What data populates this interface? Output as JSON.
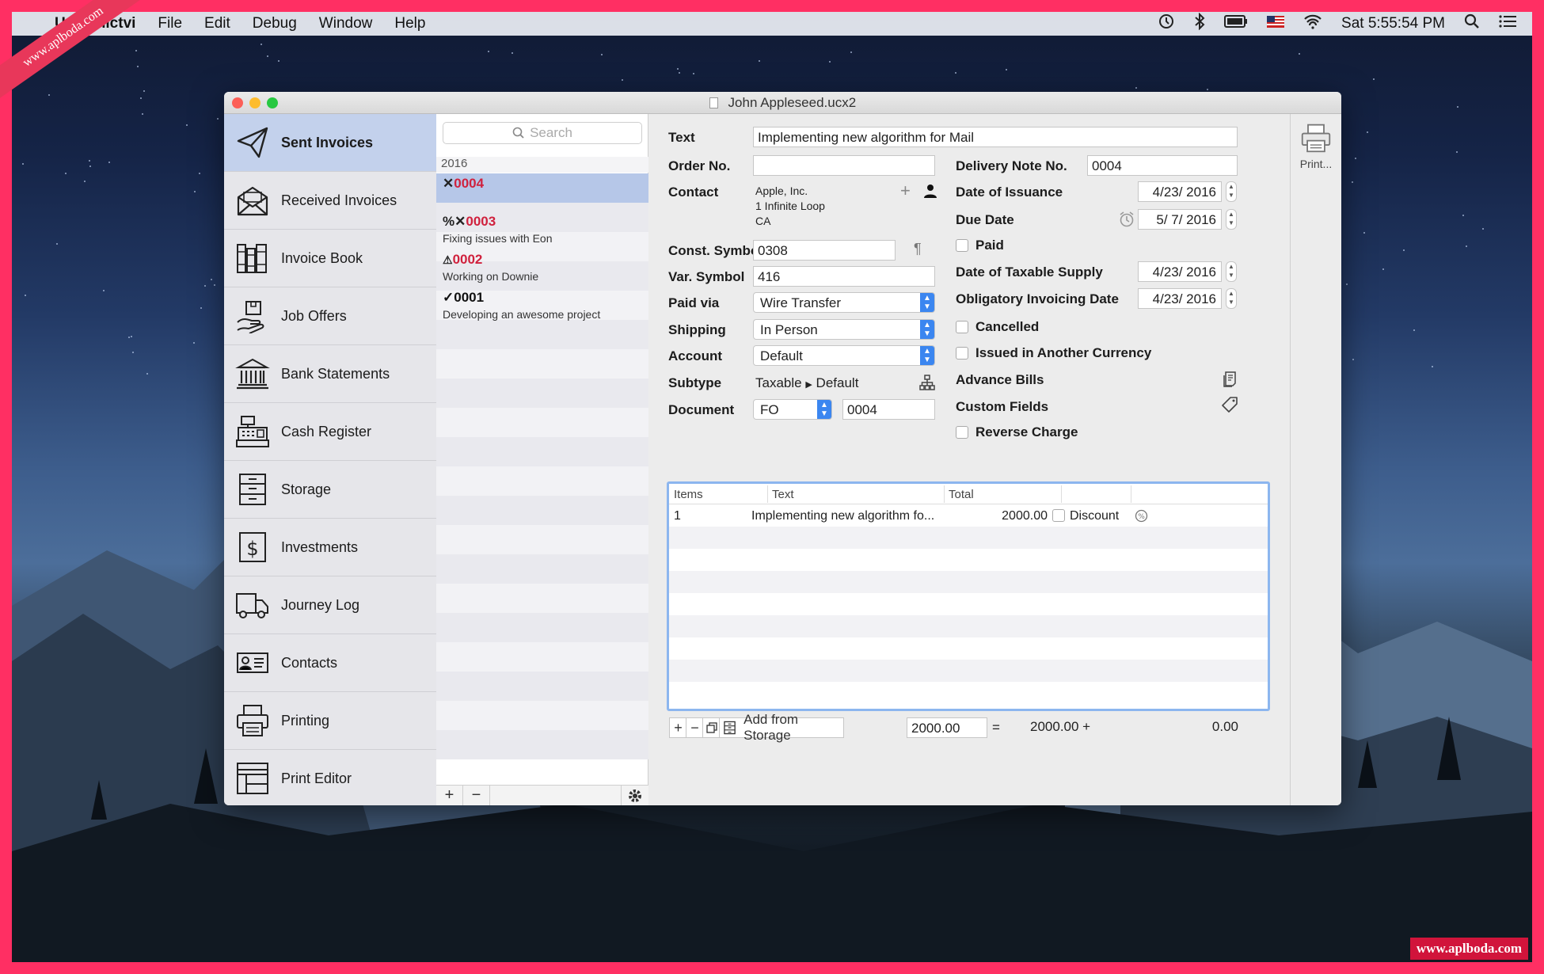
{
  "menubar": {
    "app_name": "Uctovnictvi",
    "menus": [
      "File",
      "Edit",
      "Debug",
      "Window",
      "Help"
    ],
    "clock": "Sat 5:55:54 PM"
  },
  "watermark": {
    "ribbon": "www.aplboda.com",
    "corner": "www.aplboda.com"
  },
  "window": {
    "title": "John Appleseed.ucx2"
  },
  "sidebar": {
    "items": [
      {
        "label": "Sent Invoices",
        "icon": "paper-plane-icon"
      },
      {
        "label": "Received Invoices",
        "icon": "envelope-icon"
      },
      {
        "label": "Invoice Book",
        "icon": "books-icon"
      },
      {
        "label": "Job Offers",
        "icon": "hand-box-icon"
      },
      {
        "label": "Bank Statements",
        "icon": "bank-icon"
      },
      {
        "label": "Cash Register",
        "icon": "cash-register-icon"
      },
      {
        "label": "Storage",
        "icon": "drawers-icon"
      },
      {
        "label": "Investments",
        "icon": "dollar-icon"
      },
      {
        "label": "Journey Log",
        "icon": "truck-icon"
      },
      {
        "label": "Contacts",
        "icon": "contact-card-icon"
      },
      {
        "label": "Printing",
        "icon": "printer-icon"
      },
      {
        "label": "Print Editor",
        "icon": "print-editor-icon"
      }
    ]
  },
  "list": {
    "search_placeholder": "Search",
    "year": "2016",
    "invoices": [
      {
        "prefix": "✕",
        "number": "0004",
        "desc": "",
        "status": "unpaid"
      },
      {
        "prefix": "%✕",
        "number": "0003",
        "desc": "Fixing issues with Eon",
        "status": "unpaid"
      },
      {
        "prefix": "⚠",
        "number": "0002",
        "desc": "Working on Downie",
        "status": "unpaid"
      },
      {
        "prefix": "✓",
        "number": "0001",
        "desc": "Developing an awesome project",
        "status": "paid"
      }
    ]
  },
  "detail": {
    "text_label": "Text",
    "text_value": "Implementing new algorithm for Mail",
    "order_label": "Order No.",
    "order_value": "",
    "delivery_label": "Delivery Note No.",
    "delivery_value": "0004",
    "contact_label": "Contact",
    "contact_lines": [
      "Apple, Inc.",
      "1 Infinite Loop",
      "CA"
    ],
    "issuance_label": "Date of Issuance",
    "issuance_value": "4/23/ 2016",
    "due_label": "Due Date",
    "due_value": "5/  7/ 2016",
    "const_label": "Const. Symbol",
    "const_value": "0308",
    "paid_label": "Paid",
    "var_label": "Var. Symbol",
    "var_value": "416",
    "taxable_label": "Date of Taxable Supply",
    "taxable_value": "4/23/ 2016",
    "paidvia_label": "Paid via",
    "paidvia_value": "Wire Transfer",
    "obligatory_label": "Obligatory Invoicing Date",
    "obligatory_value": "4/23/ 2016",
    "shipping_label": "Shipping",
    "shipping_value": "In Person",
    "cancelled_label": "Cancelled",
    "account_label": "Account",
    "account_value": "Default",
    "currency_label": "Issued in Another Currency",
    "subtype_label": "Subtype",
    "subtype_value1": "Taxable",
    "subtype_value2": "Default",
    "advance_label": "Advance Bills",
    "document_label": "Document",
    "document_type": "FO",
    "document_number": "0004",
    "custom_label": "Custom Fields",
    "reverse_label": "Reverse Charge"
  },
  "items": {
    "headers": [
      "Items",
      "Text",
      "Total"
    ],
    "rows": [
      {
        "qty": "1",
        "text": "Implementing new algorithm fo...",
        "total": "2000.00",
        "discount_label": "Discount"
      }
    ]
  },
  "footer": {
    "add_storage": "Add from Storage",
    "subtotal": "2000.00",
    "equals": "=",
    "total": "2000.00 +",
    "vat": "0.00"
  },
  "print": {
    "label": "Print..."
  }
}
